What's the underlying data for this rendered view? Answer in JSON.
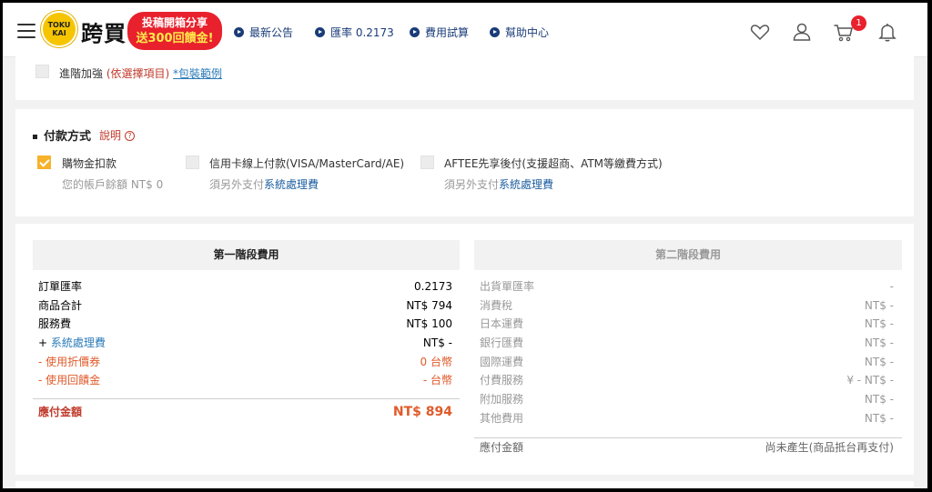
{
  "header": {
    "logo_badge_top": "TOKU",
    "logo_badge_bottom": "KAI",
    "logo_text": "跨買",
    "promo_line1": "投稿開箱分享",
    "promo_line2": "送300回饋金!",
    "nav": [
      "最新公告",
      "匯率 0.2173",
      "費用試算",
      "幫助中心"
    ],
    "cart_count": "1"
  },
  "packing": {
    "label": "進階加強",
    "optional_note": "(依選擇項目)",
    "example_link": "*包裝範例"
  },
  "payment": {
    "title": "付款方式",
    "help_label": "說明",
    "help_mark": "?",
    "options": [
      {
        "label": "購物金扣款",
        "sub": "您的帳戶餘額 NT$ 0",
        "sub_link": "",
        "checked": true
      },
      {
        "label": "信用卡線上付款(VISA/MasterCard/AE)",
        "sub": "須另外支付",
        "sub_link": "系統處理費",
        "checked": false
      },
      {
        "label": "AFTEE先享後付(支援超商、ATM等繳費方式)",
        "sub": "須另外支付",
        "sub_link": "系統處理費",
        "checked": false
      }
    ]
  },
  "stage1": {
    "title": "第一階段費用",
    "rows": [
      {
        "label": "訂單匯率",
        "value": "0.2173"
      },
      {
        "label": "商品合計",
        "value": "NT$ 794"
      },
      {
        "label": "服務費",
        "value": "NT$ 100"
      },
      {
        "prefix": "+ ",
        "label": "系統處理費",
        "value": "NT$ -"
      },
      {
        "prefix": "- ",
        "label": "使用折價券",
        "value": "0 台幣"
      },
      {
        "prefix": "- ",
        "label": "使用回饋金",
        "value": "- 台幣"
      }
    ],
    "total_label": "應付金額",
    "total_value": "NT$ 894"
  },
  "stage2": {
    "title": "第二階段費用",
    "rows": [
      {
        "label": "出貨單匯率",
        "value": "-"
      },
      {
        "label": "消費稅",
        "value": "NT$ -"
      },
      {
        "label": "日本運費",
        "value": "NT$ -"
      },
      {
        "label": "銀行匯費",
        "value": "NT$ -"
      },
      {
        "label": "國際運費",
        "value": "NT$ -"
      },
      {
        "label": "付費服務",
        "value": "¥ - NT$ -"
      },
      {
        "label": "附加服務",
        "value": "NT$ -"
      },
      {
        "label": "其他費用",
        "value": "NT$ -"
      }
    ],
    "total_label": "應付金額",
    "total_value": "尚未產生(商品抵台再支付)"
  },
  "colors": {
    "accent_red": "#e8212d",
    "checkbox_orange": "#f6b22b",
    "link_blue": "#2a7bb8",
    "nav_blue": "#1a3c78",
    "total_orange": "#e05a2a"
  }
}
